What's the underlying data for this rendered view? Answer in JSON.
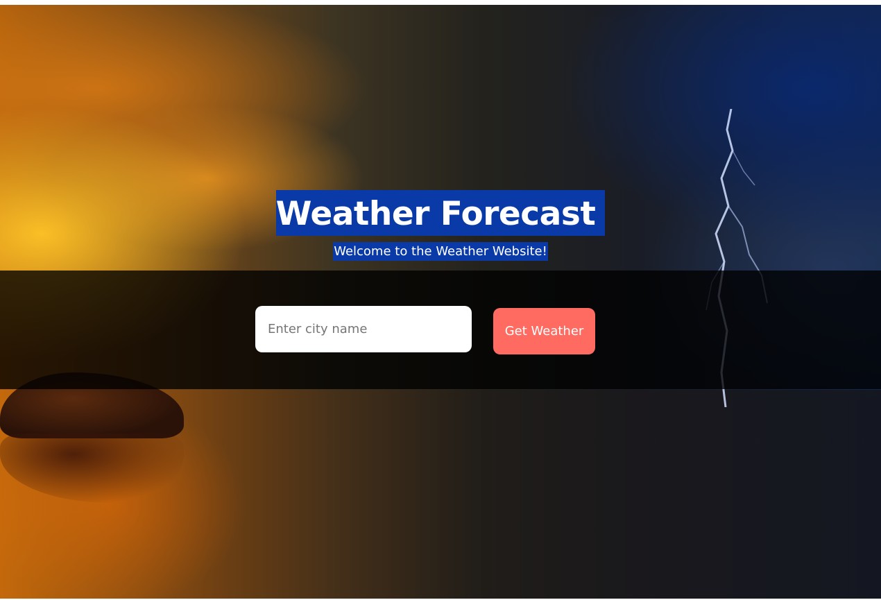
{
  "header": {
    "title": "Weather Forecast",
    "subtitle": "Welcome to the Weather Website!"
  },
  "search": {
    "placeholder": "Enter city name",
    "value": "",
    "button_label": "Get Weather"
  },
  "colors": {
    "title_highlight": "#0a3aa8",
    "button_background": "#ff6b61",
    "search_band": "#000000"
  }
}
